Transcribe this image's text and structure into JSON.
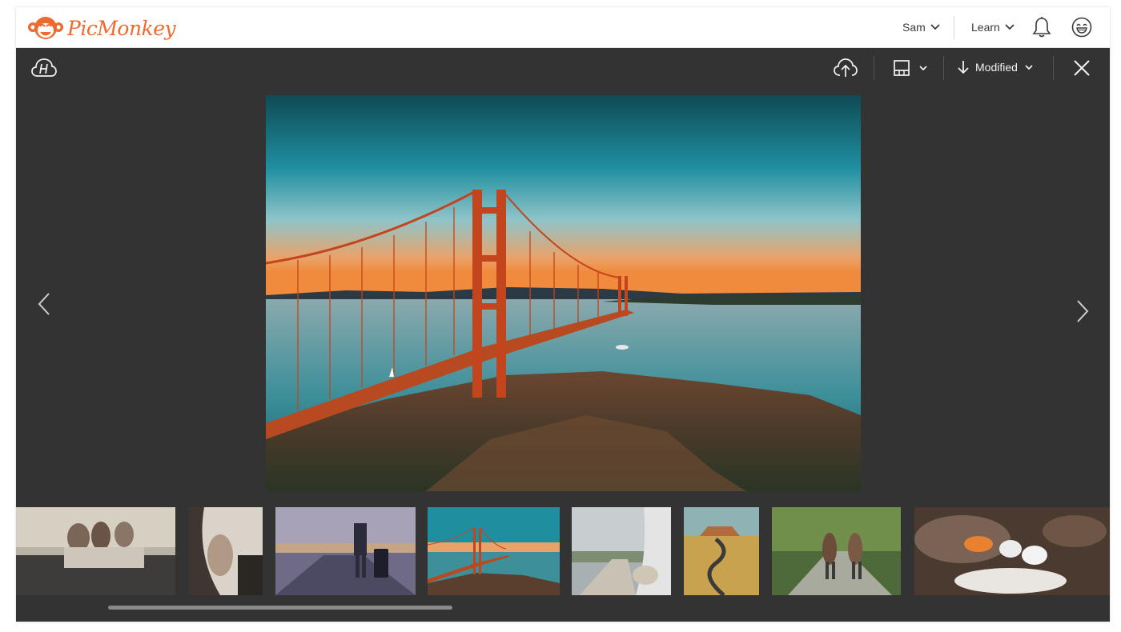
{
  "header": {
    "brand": "PicMonkey",
    "user_menu": "Sam",
    "learn_menu": "Learn",
    "icons": [
      "bell-icon",
      "smiley-avatar-icon",
      "chevron-down-icon"
    ],
    "brand_color": "#ee6a2f"
  },
  "viewer": {
    "toolbar": {
      "hub_icon": "hub-cloud-icon",
      "upload_icon": "cloud-upload-icon",
      "layout_icon": "layout-icon",
      "sort_label": "Modified",
      "sort_icon": "arrow-down-icon",
      "close_icon": "close-icon"
    },
    "main_photo": "Golden Gate Bridge at sunset with teal sky",
    "nav": {
      "prev": "chevron-left-icon",
      "next": "chevron-right-icon"
    },
    "thumbnails": [
      "friends sitting on car roof",
      "car interior window",
      "traveler with suitcase on road",
      "Golden Gate Bridge",
      "car side mirror on road",
      "winding desert road",
      "two girls walking in forest",
      "marshmallows over campfire"
    ],
    "selected_thumbnail_index": 3,
    "colors": {
      "background": "#333333",
      "topbar": "#ffffff"
    }
  }
}
